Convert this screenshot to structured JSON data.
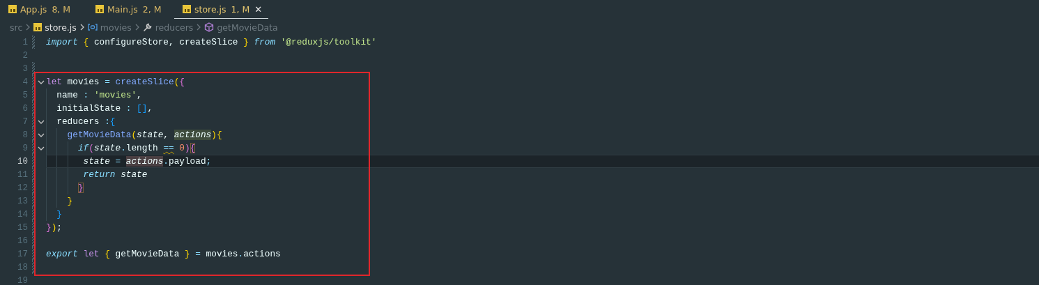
{
  "tabs": [
    {
      "name": "App.js",
      "status": "8, M",
      "selected": false
    },
    {
      "name": "Main.js",
      "status": "2, M",
      "selected": false
    },
    {
      "name": "store.js",
      "status": "1, M",
      "selected": true,
      "close": "✕"
    }
  ],
  "breadcrumb": [
    {
      "label": "src",
      "kind": "folder"
    },
    {
      "label": "store.js",
      "kind": "file"
    },
    {
      "label": "movies",
      "kind": "variable"
    },
    {
      "label": "reducers",
      "kind": "property"
    },
    {
      "label": "getMovieData",
      "kind": "method"
    }
  ],
  "lines": [
    {
      "number": "1",
      "changed": true,
      "fold": false,
      "current": false,
      "tokens": [
        {
          "text": "import ",
          "kind": "control"
        },
        {
          "text": "{ ",
          "kind": "b1"
        },
        {
          "text": "configureStore, createSlice ",
          "kind": "plain"
        },
        {
          "text": "} ",
          "kind": "b1"
        },
        {
          "text": "from ",
          "kind": "control"
        },
        {
          "text": "'@reduxjs/toolkit'",
          "kind": "string"
        }
      ]
    },
    {
      "number": "2",
      "changed": false,
      "fold": false,
      "current": false
    },
    {
      "number": "3",
      "changed": true,
      "fold": false,
      "current": false
    },
    {
      "number": "4",
      "changed": true,
      "fold": true,
      "current": false,
      "tokens": [
        {
          "text": "let ",
          "kind": "keyword"
        },
        {
          "text": "movies ",
          "kind": "plain"
        },
        {
          "text": "= ",
          "kind": "operator"
        },
        {
          "text": "createSlice",
          "kind": "function"
        },
        {
          "text": "(",
          "kind": "b1"
        },
        {
          "text": "{",
          "kind": "b2"
        }
      ]
    },
    {
      "number": "5",
      "changed": true,
      "fold": false,
      "current": false,
      "tokens": [
        {
          "text": "  name ",
          "kind": "plain"
        },
        {
          "text": ": ",
          "kind": "operator"
        },
        {
          "text": "'movies'",
          "kind": "string"
        },
        {
          "text": ",",
          "kind": "plain"
        }
      ]
    },
    {
      "number": "6",
      "changed": true,
      "fold": false,
      "current": false,
      "tokens": [
        {
          "text": "  initialState ",
          "kind": "plain"
        },
        {
          "text": ": ",
          "kind": "operator"
        },
        {
          "text": "[]",
          "kind": "b3"
        },
        {
          "text": ",",
          "kind": "plain"
        }
      ]
    },
    {
      "number": "7",
      "changed": true,
      "fold": true,
      "current": false,
      "tokens": [
        {
          "text": "  reducers ",
          "kind": "plain"
        },
        {
          "text": ":",
          "kind": "operator"
        },
        {
          "text": "{",
          "kind": "b3"
        }
      ]
    },
    {
      "number": "8",
      "changed": true,
      "fold": true,
      "current": false,
      "tokens": [
        {
          "text": "    getMovieData",
          "kind": "function"
        },
        {
          "text": "(",
          "kind": "b1"
        },
        {
          "text": "state",
          "kind": "parameter"
        },
        {
          "text": ", ",
          "kind": "plain"
        },
        {
          "text": "actions",
          "kind": "parameter",
          "highlighted": true,
          "write_access": false
        },
        {
          "text": ")",
          "kind": "b1"
        },
        {
          "text": "{",
          "kind": "b1"
        }
      ]
    },
    {
      "number": "9",
      "changed": true,
      "fold": true,
      "current": false,
      "tokens": [
        {
          "text": "      if",
          "kind": "control"
        },
        {
          "text": "(",
          "kind": "b2"
        },
        {
          "text": "state",
          "kind": "parameter"
        },
        {
          "text": ".",
          "kind": "operator"
        },
        {
          "text": "length ",
          "kind": "plain"
        },
        {
          "text": "==",
          "kind": "operator",
          "squiggle": true
        },
        {
          "text": " 0",
          "kind": "number"
        },
        {
          "text": ")",
          "kind": "b2"
        },
        {
          "text": "{",
          "kind": "b2",
          "match": true
        }
      ]
    },
    {
      "number": "10",
      "changed": true,
      "fold": false,
      "current": true,
      "tokens": [
        {
          "text": "       state ",
          "kind": "parameter"
        },
        {
          "text": "= ",
          "kind": "operator"
        },
        {
          "text": "actions",
          "kind": "parameter",
          "highlighted": true,
          "write_access": true
        },
        {
          "text": ".",
          "kind": "operator"
        },
        {
          "text": "payload",
          "kind": "plain"
        },
        {
          "text": ";",
          "kind": "operator"
        }
      ]
    },
    {
      "number": "11",
      "changed": true,
      "fold": false,
      "current": false,
      "tokens": [
        {
          "text": "       return ",
          "kind": "control"
        },
        {
          "text": "state",
          "kind": "parameter"
        }
      ]
    },
    {
      "number": "12",
      "changed": true,
      "fold": false,
      "current": false,
      "tokens": [
        {
          "text": "      }",
          "kind": "b2",
          "match": true
        }
      ]
    },
    {
      "number": "13",
      "changed": true,
      "fold": false,
      "current": false,
      "tokens": [
        {
          "text": "    }",
          "kind": "b1"
        }
      ]
    },
    {
      "number": "14",
      "changed": true,
      "fold": false,
      "current": false,
      "tokens": [
        {
          "text": "  }",
          "kind": "b3"
        }
      ]
    },
    {
      "number": "15",
      "changed": true,
      "fold": false,
      "current": false,
      "tokens": [
        {
          "text": "}",
          "kind": "b2"
        },
        {
          "text": ")",
          "kind": "b1"
        },
        {
          "text": ";",
          "kind": "plain"
        }
      ]
    },
    {
      "number": "16",
      "changed": true,
      "fold": false,
      "current": false
    },
    {
      "number": "17",
      "changed": true,
      "fold": false,
      "current": false,
      "tokens": [
        {
          "text": "export ",
          "kind": "control"
        },
        {
          "text": "let ",
          "kind": "keyword"
        },
        {
          "text": "{ ",
          "kind": "b1"
        },
        {
          "text": "getMovieData ",
          "kind": "plain"
        },
        {
          "text": "} ",
          "kind": "b1"
        },
        {
          "text": "= ",
          "kind": "operator"
        },
        {
          "text": "movies",
          "kind": "plain"
        },
        {
          "text": ".",
          "kind": "operator"
        },
        {
          "text": "actions",
          "kind": "plain"
        }
      ]
    },
    {
      "number": "18",
      "changed": true,
      "fold": false,
      "current": false
    },
    {
      "number": "19",
      "changed": false,
      "fold": false,
      "current": false
    }
  ],
  "annotation": {
    "kind": "rectangle",
    "color": "#e0262b"
  }
}
